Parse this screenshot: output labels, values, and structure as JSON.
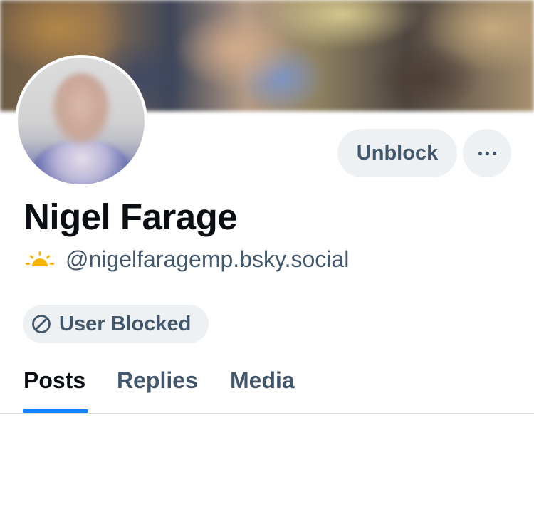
{
  "profile": {
    "display_name": "Nigel Farage",
    "handle": "@nigelfaragemp.bsky.social",
    "handle_icon": "sun-icon",
    "blocked_label": "User Blocked"
  },
  "actions": {
    "unblock_label": "Unblock",
    "more_icon": "more-horizontal-icon"
  },
  "tabs": [
    {
      "label": "Posts",
      "active": true
    },
    {
      "label": "Replies",
      "active": false
    },
    {
      "label": "Media",
      "active": false
    }
  ],
  "colors": {
    "accent": "#1083fe",
    "text_primary": "#0b0f14",
    "text_secondary": "#42576c",
    "pill_background": "#eef1f4",
    "sun_icon": "#f5b400"
  }
}
